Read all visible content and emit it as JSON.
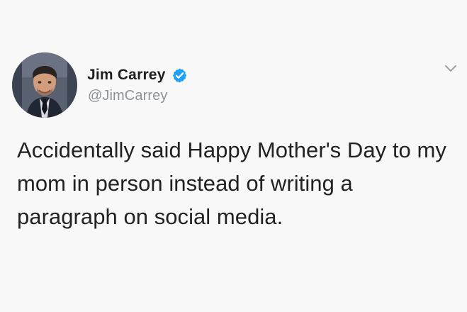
{
  "tweet": {
    "author": {
      "display_name": "Jim Carrey",
      "handle": "@JimCarrey",
      "verified": true,
      "verified_icon": "verified-check-icon",
      "verified_color": "#1da1f2"
    },
    "menu_icon": "chevron-down-icon",
    "text": "Accidentally said Happy Mother's Day to my mom in person instead of writing a paragraph on social media."
  },
  "colors": {
    "background": "#f8f8f8",
    "name": "#1f1f1f",
    "handle": "#8d9399",
    "body_text": "#222222"
  }
}
